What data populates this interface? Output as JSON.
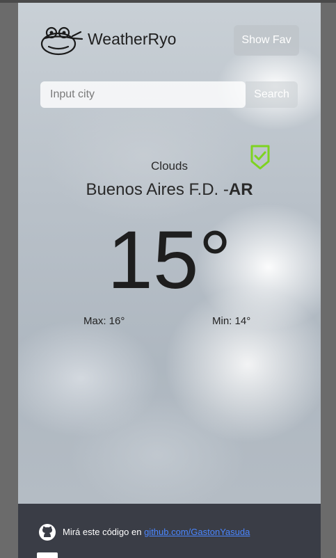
{
  "app": {
    "brand": "WeatherRyo"
  },
  "header": {
    "fav_label": "Show Fav"
  },
  "search": {
    "placeholder": "Input city",
    "button_label": "Search"
  },
  "weather": {
    "condition": "Clouds",
    "city": "Buenos Aires F.D. -",
    "country": "AR",
    "temperature": "15°",
    "max": "Max: 16°",
    "min": "Min: 14°"
  },
  "footer": {
    "text": "Mirá este código en ",
    "link_text": "github.com/GastonYasuda"
  },
  "colors": {
    "accent_green": "#7ed321",
    "footer_bg": "#3a3d46",
    "link": "#4a86ff"
  }
}
